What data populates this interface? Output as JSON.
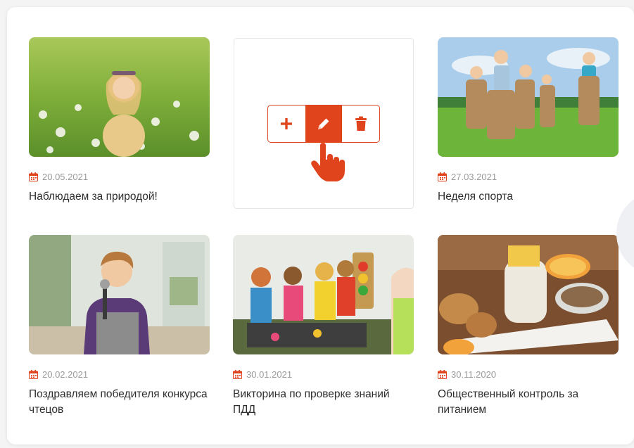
{
  "cards": [
    {
      "date": "20.05.2021",
      "title": "Наблюдаем за природой!",
      "image": "girl-dandelion-field-photo"
    },
    {
      "placeholder": true
    },
    {
      "date": "27.03.2021",
      "title": "Неделя спорта",
      "image": "kids-sack-race-photo"
    },
    {
      "date": "20.02.2021",
      "title": "Поздравляем победителя конкурса чтецов",
      "image": "boy-microphone-photo"
    },
    {
      "date": "30.01.2021",
      "title": "Викторина по проверке знаний ПДД",
      "image": "kids-traffic-rules-photo"
    },
    {
      "date": "30.11.2020",
      "title": "Общественный контроль за питанием",
      "image": "yogurt-breakfast-photo"
    }
  ],
  "toolbar": {
    "buttons": [
      {
        "icon": "plus-icon",
        "action": "add"
      },
      {
        "icon": "pencil-icon",
        "action": "edit",
        "active": true
      },
      {
        "icon": "trash-icon",
        "action": "delete"
      }
    ]
  },
  "colors": {
    "accent": "#e0441d",
    "date_text": "#9a9a9a",
    "title_text": "#2e2e2e"
  }
}
